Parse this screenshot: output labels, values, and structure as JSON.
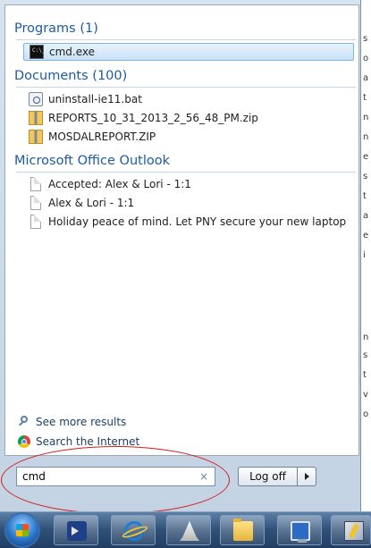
{
  "background_window": {
    "fragments": [
      "s",
      "o",
      "a",
      "t",
      "n",
      "n",
      "e",
      "s",
      "t",
      "a",
      "e",
      "i",
      "n",
      "s",
      "t",
      "v",
      "o"
    ]
  },
  "results": {
    "programs": {
      "header": "Programs (1)",
      "items": [
        {
          "label": "cmd.exe",
          "icon": "cmd-icon",
          "selected": true
        }
      ]
    },
    "documents": {
      "header": "Documents (100)",
      "items": [
        {
          "label": "uninstall-ie11.bat",
          "icon": "batch-file-icon"
        },
        {
          "label": "REPORTS_10_31_2013_2_56_48_PM.zip",
          "icon": "zip-folder-icon"
        },
        {
          "label": "MOSDALREPORT.ZIP",
          "icon": "zip-folder-icon"
        }
      ]
    },
    "outlook": {
      "header": "Microsoft Office Outlook",
      "items": [
        {
          "label": "Accepted: Alex & Lori - 1:1",
          "icon": "document-icon"
        },
        {
          "label": "Alex & Lori - 1:1",
          "icon": "document-icon"
        },
        {
          "label": "Holiday peace of mind. Let PNY secure your new laptop",
          "icon": "document-icon"
        }
      ]
    }
  },
  "links": {
    "see_more": "See more results",
    "search_internet": "Search the Internet"
  },
  "search": {
    "value": "cmd",
    "clear_glyph": "×"
  },
  "power": {
    "logoff_label": "Log off"
  },
  "colors": {
    "header_blue": "#1d5a9e",
    "annotation_red": "#d21d1d",
    "taskbar_blue": "#2f4f76"
  },
  "taskbar": {
    "buttons": [
      "powershell-icon",
      "internet-explorer-icon",
      "cone-app-icon",
      "file-explorer-icon",
      "remote-desktop-icon",
      "putty-icon"
    ]
  }
}
